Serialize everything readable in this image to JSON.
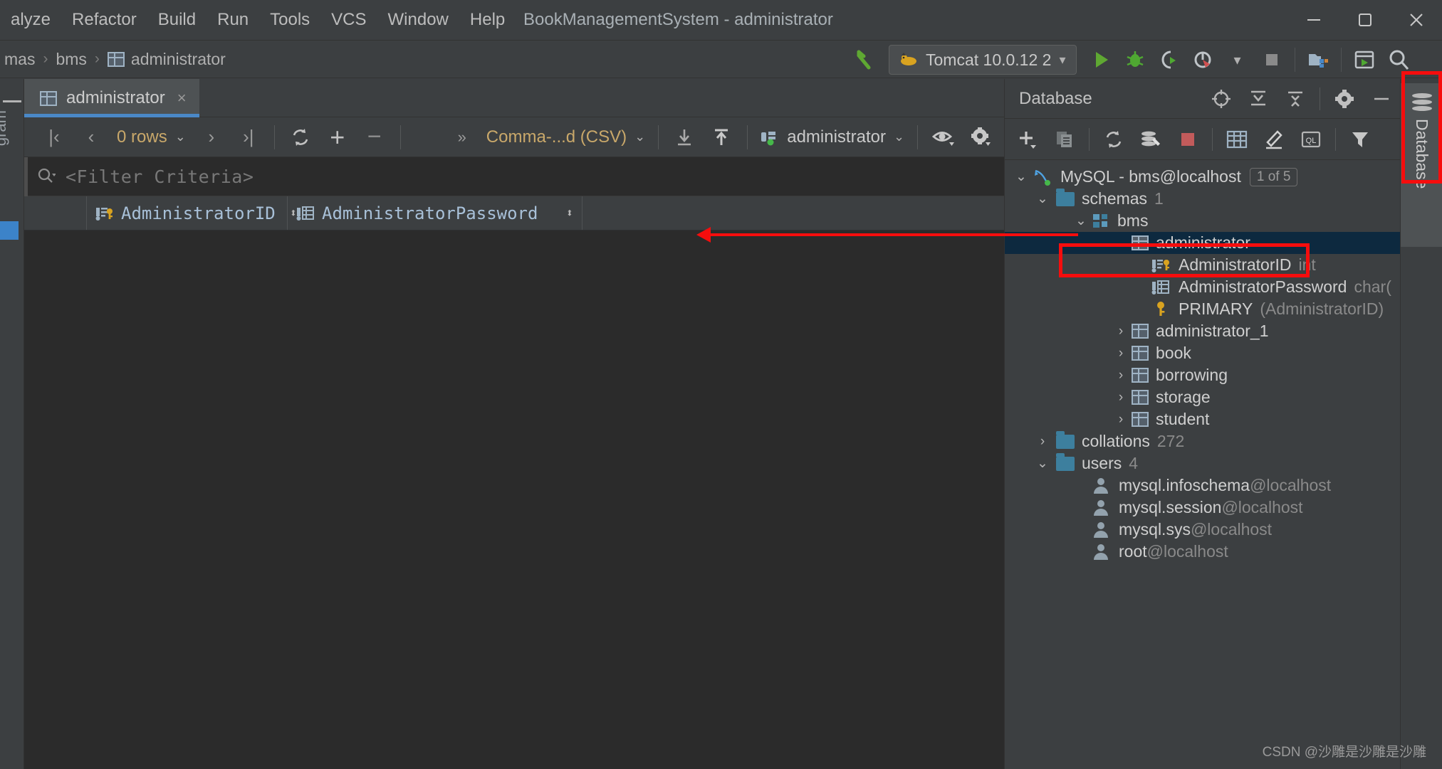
{
  "window": {
    "title": "BookManagementSystem - administrator",
    "controls": {
      "minimize": "minimize-icon",
      "maximize": "maximize-icon",
      "close": "close-icon"
    }
  },
  "menu": {
    "items": [
      {
        "label": "alyze",
        "mnemonic": "y"
      },
      {
        "label": "Refactor",
        "mnemonic": "R"
      },
      {
        "label": "Build",
        "mnemonic": "B"
      },
      {
        "label": "Run",
        "mnemonic": "u"
      },
      {
        "label": "Tools",
        "mnemonic": "T"
      },
      {
        "label": "VCS",
        "mnemonic": ""
      },
      {
        "label": "Window",
        "mnemonic": "W"
      },
      {
        "label": "Help",
        "mnemonic": "H"
      }
    ]
  },
  "breadcrumb": {
    "items": [
      {
        "label": "mas",
        "icon": ""
      },
      {
        "label": "bms",
        "icon": ""
      },
      {
        "label": "administrator",
        "icon": "table-icon"
      }
    ],
    "separator": "›"
  },
  "run_toolbar": {
    "back_icon": "back-arrow-icon",
    "config_name": "Tomcat 10.0.12 2",
    "config_icon": "tomcat-icon",
    "config_caret": "▾",
    "buttons": [
      {
        "name": "run-button",
        "icon": "play-icon",
        "color": "#5fa832"
      },
      {
        "name": "debug-button",
        "icon": "bug-icon",
        "color": "#4fa832"
      },
      {
        "name": "run-with-coverage-button",
        "icon": "coverage-icon",
        "color": "#bfc4c8"
      },
      {
        "name": "profile-button",
        "icon": "profiler-icon",
        "color": "#bfc4c8"
      },
      {
        "name": "profile-dropdown",
        "icon": "chevron-down-icon",
        "color": "#b0b0b0"
      },
      {
        "name": "stop-button",
        "icon": "stop-square-icon",
        "color": "#8a8a8a"
      },
      {
        "name": "project-structure-button",
        "icon": "project-structure-icon",
        "color": "#bfc4c8"
      },
      {
        "name": "updating-button",
        "icon": "window-run-icon",
        "color": "#bfc4c8"
      },
      {
        "name": "search-everywhere-button",
        "icon": "search-icon",
        "color": "#bfc4c8"
      }
    ]
  },
  "left_strip": {
    "label": "gram",
    "collapse_icon": "collapse-icon"
  },
  "editor_tab": {
    "label": "administrator",
    "icon": "table-icon",
    "close": "×"
  },
  "grid_toolbar": {
    "first_page": "|‹",
    "prev_page": "‹",
    "rows_label": "0 rows",
    "rows_caret": "⌵",
    "next_page": "›",
    "last_page": "›|",
    "reload_icon": "refresh-icon",
    "add_row": "+",
    "delete_row": "−",
    "expand_more": "»",
    "format_label": "Comma-...d (CSV)",
    "format_caret": "⌵",
    "import_icon": "download-icon",
    "export_icon": "upload-icon",
    "session_label": "administrator",
    "session_icon": "data-source-icon",
    "session_caret": "⌵",
    "view_icon": "eye-icon",
    "settings_icon": "gear-icon"
  },
  "filter_row": {
    "icon": "search-icon",
    "placeholder": "<Filter Criteria>"
  },
  "grid_columns": [
    {
      "name": "AdministratorID",
      "icon": "primary-key-column-icon",
      "sort": "↕"
    },
    {
      "name": "AdministratorPassword",
      "icon": "column-icon",
      "sort": "↕"
    }
  ],
  "grid_rows": [],
  "database_panel": {
    "title": "Database",
    "header_icons": [
      {
        "name": "locate-icon",
        "glyph": "⊕"
      },
      {
        "name": "expand-all-icon",
        "glyph": "↧"
      },
      {
        "name": "collapse-all-icon",
        "glyph": "↥"
      },
      {
        "name": "gear-icon",
        "glyph": "⚙"
      },
      {
        "name": "hide-icon",
        "glyph": "−"
      }
    ],
    "toolbar_icons": [
      {
        "name": "add-icon",
        "glyph": "+"
      },
      {
        "name": "duplicate-icon",
        "glyph": "⧉"
      },
      {
        "name": "refresh-icon",
        "glyph": "↻"
      },
      {
        "name": "db-tools-icon",
        "glyph": "⚒"
      },
      {
        "name": "stop-icon",
        "glyph": "■"
      },
      {
        "name": "table-editor-icon",
        "glyph": "▦"
      },
      {
        "name": "modify-icon",
        "glyph": "✎"
      },
      {
        "name": "query-console-icon",
        "glyph": "QL"
      },
      {
        "name": "filter-icon",
        "glyph": "ᐃ"
      }
    ],
    "tree": [
      {
        "id": "mysql-root",
        "depth": 0,
        "chevron": "⌄",
        "icon": "mysql-dolphin-icon",
        "label": "MySQL - bms@localhost",
        "badge": "1 of 5",
        "selected": false
      },
      {
        "id": "schemas",
        "depth": 1,
        "chevron": "⌄",
        "icon": "folder-icon",
        "label": "schemas",
        "count": "1",
        "selected": false
      },
      {
        "id": "bms",
        "depth": 2,
        "chevron": "⌄",
        "icon": "schema-icon",
        "label": "bms",
        "selected": false
      },
      {
        "id": "administrator",
        "depth": 3,
        "chevron": "⌄",
        "icon": "table-icon",
        "label": "administrator",
        "selected": true
      },
      {
        "id": "administratorid",
        "depth": 4,
        "chevron": "",
        "icon": "primary-key-column-icon",
        "label": "AdministratorID",
        "type": "int",
        "selected": false
      },
      {
        "id": "administratorpassword",
        "depth": 4,
        "chevron": "",
        "icon": "column-icon",
        "label": "AdministratorPassword",
        "type": "char(",
        "selected": false
      },
      {
        "id": "primary",
        "depth": 4,
        "chevron": "",
        "icon": "key-icon",
        "label": "PRIMARY",
        "type": "(AdministratorID)",
        "selected": false
      },
      {
        "id": "administrator_1",
        "depth": 3,
        "chevron": "›",
        "icon": "table-icon",
        "label": "administrator_1",
        "selected": false
      },
      {
        "id": "book",
        "depth": 3,
        "chevron": "›",
        "icon": "table-icon",
        "label": "book",
        "selected": false
      },
      {
        "id": "borrowing",
        "depth": 3,
        "chevron": "›",
        "icon": "table-icon",
        "label": "borrowing",
        "selected": false
      },
      {
        "id": "storage",
        "depth": 3,
        "chevron": "›",
        "icon": "table-icon",
        "label": "storage",
        "selected": false
      },
      {
        "id": "student",
        "depth": 3,
        "chevron": "›",
        "icon": "table-icon",
        "label": "student",
        "selected": false
      },
      {
        "id": "collations",
        "depth": 1,
        "chevron": "›",
        "icon": "folder-icon",
        "label": "collations",
        "count": "272",
        "selected": false
      },
      {
        "id": "users",
        "depth": 1,
        "chevron": "⌄",
        "icon": "folder-icon",
        "label": "users",
        "count": "4",
        "selected": false
      },
      {
        "id": "user-infoschema",
        "depth": 2,
        "chevron": "",
        "icon": "user-icon",
        "label": "mysql.infoschema",
        "host": "@localhost",
        "selected": false
      },
      {
        "id": "user-session",
        "depth": 2,
        "chevron": "",
        "icon": "user-icon",
        "label": "mysql.session",
        "host": "@localhost",
        "selected": false
      },
      {
        "id": "user-sys",
        "depth": 2,
        "chevron": "",
        "icon": "user-icon",
        "label": "mysql.sys",
        "host": "@localhost",
        "selected": false
      },
      {
        "id": "user-root",
        "depth": 2,
        "chevron": "",
        "icon": "user-icon",
        "label": "root",
        "host": "@localhost",
        "selected": false
      }
    ]
  },
  "right_sidebar": {
    "tab_label": "Database",
    "tab_icon": "database-cylinder-icon"
  },
  "annotations": {
    "color": "#f60d0d",
    "boxes": [
      {
        "name": "administrator-node-highlight"
      },
      {
        "name": "database-tool-tab-highlight"
      }
    ],
    "arrow": {
      "name": "pointer-arrow-to-column-header"
    }
  },
  "watermark": {
    "text": "CSDN @沙雕是沙雕是沙雕"
  }
}
